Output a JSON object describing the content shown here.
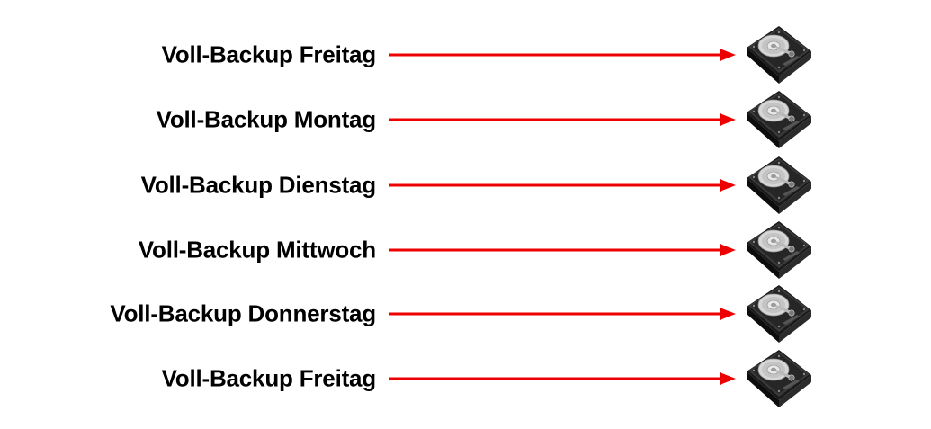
{
  "diagram": {
    "arrow_color": "#ee0000",
    "drive_icon": "hard-drive-icon",
    "rows": [
      {
        "label": "Voll-Backup Freitag"
      },
      {
        "label": "Voll-Backup Montag"
      },
      {
        "label": "Voll-Backup Dienstag"
      },
      {
        "label": "Voll-Backup Mittwoch"
      },
      {
        "label": "Voll-Backup Donnerstag"
      },
      {
        "label": "Voll-Backup Freitag"
      }
    ]
  }
}
